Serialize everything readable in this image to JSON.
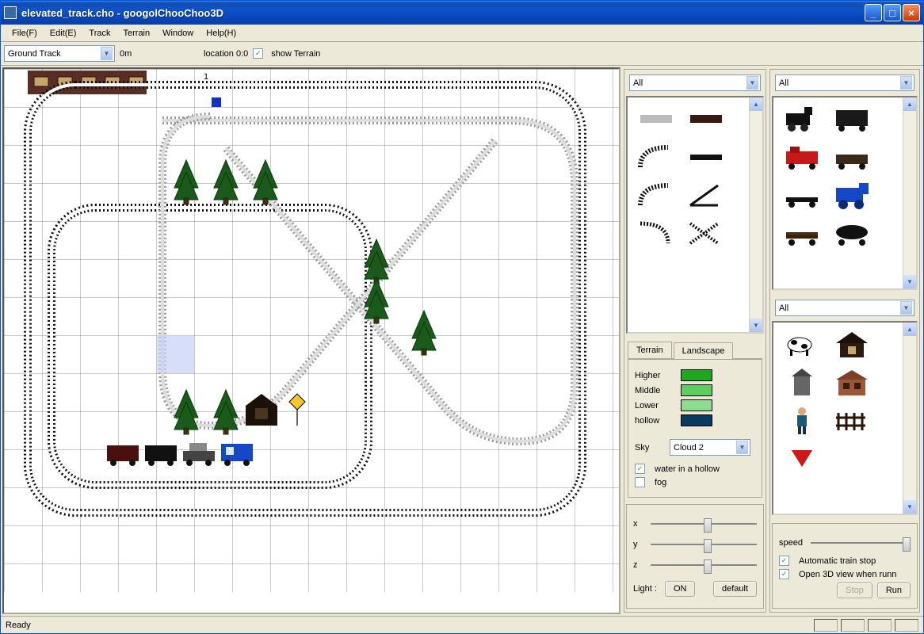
{
  "window": {
    "title": "elevated_track.cho - googolChooChoo3D"
  },
  "menu": [
    "File(F)",
    "Edit(E)",
    "Track",
    "Terrain",
    "Window",
    "Help(H)"
  ],
  "toolbar": {
    "track_layer": "Ground Track",
    "height": "0m",
    "location": "location 0:0",
    "show_terrain_label": "show Terrain",
    "show_terrain_checked": true
  },
  "canvas": {
    "marker": "1"
  },
  "track_palette": {
    "filter": "All"
  },
  "train_palette": {
    "filter": "All"
  },
  "object_palette": {
    "filter": "All"
  },
  "tabs": {
    "items": [
      "Terrain",
      "Landscape"
    ],
    "active": 1
  },
  "landscape": {
    "levels": [
      {
        "label": "Higher",
        "color": "#1fa81f"
      },
      {
        "label": "Middle",
        "color": "#5ecf5e"
      },
      {
        "label": "Lower",
        "color": "#8edc8e"
      },
      {
        "label": "hollow",
        "color": "#0b3a5f"
      }
    ],
    "sky_label": "Sky",
    "sky_value": "Cloud 2",
    "water_label": "water in a hollow",
    "water_checked": true,
    "fog_label": "fog",
    "fog_checked": false
  },
  "transform": {
    "axes": [
      "x",
      "y",
      "z"
    ],
    "light_label": "Light :",
    "light_value": "ON",
    "default_label": "default"
  },
  "run": {
    "speed_label": "speed",
    "auto_stop_label": "Automatic train stop",
    "auto_stop_checked": true,
    "open3d_label": "Open 3D view when runn",
    "open3d_checked": true,
    "stop_label": "Stop",
    "run_label": "Run"
  },
  "status": "Ready"
}
